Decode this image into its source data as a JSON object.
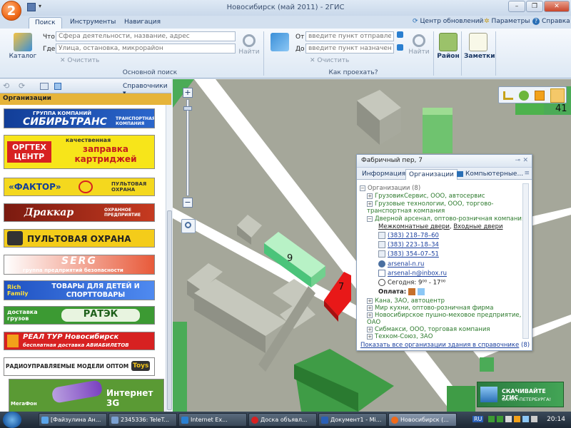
{
  "window": {
    "title": "Новосибирск (май 2011) - 2ГИС",
    "logo_text": "2",
    "btn_min": "–",
    "btn_max": "❐",
    "btn_close": "✕"
  },
  "tabs": [
    "Поиск",
    "Инструменты",
    "Навигация"
  ],
  "top_links": {
    "updates": "Центр обновлений",
    "params": "Параметры",
    "help": "Справка"
  },
  "ribbon": {
    "catalog": "Каталог",
    "what_label": "Что",
    "where_label": "Где",
    "what_placeholder": "Сфера деятельности, название, адрес",
    "where_placeholder": "Улица, остановка, микрорайон",
    "clear": "Очистить",
    "find": "Найти",
    "group1": "Основной поиск",
    "from_label": "От",
    "to_label": "До",
    "from_placeholder": "введите пункт отправления",
    "to_placeholder": "введите пункт назначения",
    "group2": "Как проехать?",
    "district": "Район",
    "notes": "Заметки"
  },
  "left_panel": {
    "directories": "Справочники",
    "section": "Организации",
    "ads": [
      {
        "main": "ГРУППА КОМПАНИЙ",
        "big": "СИБИРЬТРАНС",
        "sub": "ТРАНСПОРТНАЯ КОМПАНИЯ"
      },
      {
        "main": "ОРГТЕХ ЦЕНТР",
        "big": "заправка картриджей",
        "sub": "качественная"
      },
      {
        "main": "«ФАКТОР»",
        "big": "ПУЛЬТОВАЯ ОХРАНА",
        "sub": ""
      },
      {
        "main": "Драккар",
        "big": "ОХРАННОЕ ПРЕДПРИЯТИЕ",
        "sub": ""
      },
      {
        "main": "ПУЛЬТОВАЯ ОХРАНА",
        "big": "",
        "sub": ""
      },
      {
        "main": "SERG",
        "big": "",
        "sub": "группа предприятий безопасности"
      },
      {
        "main": "Rich Family",
        "big": "ТОВАРЫ ДЛЯ ДЕТЕЙ И СПОРТТОВАРЫ",
        "sub": ""
      },
      {
        "main": "доставка грузов",
        "big": "РАТЭК",
        "sub": ""
      },
      {
        "main": "РЕАЛ ТУР Новосибирск",
        "big": "",
        "sub": "бесплатная доставка АВИАБИЛЕТОВ"
      },
      {
        "main": "РАДИОУПРАВЛЯЕМЫЕ МОДЕЛИ ОПТОМ",
        "big": "Toys",
        "sub": ""
      },
      {
        "main": "МегаФон",
        "big": "Интернет 3G",
        "sub": ""
      }
    ]
  },
  "map": {
    "building9": "9",
    "building7": "7",
    "building41": "41",
    "promo_main": "СКАЧИВАЙТЕ 2ГИС",
    "promo_sub": "САНКТ-ПЕТЕРБУРГА!"
  },
  "popup": {
    "title": "Фабричный пер, 7",
    "tabs": [
      "Информация",
      "Организации",
      "Компьютерные..."
    ],
    "root": "Организации (8)",
    "orgs_top": [
      "ГрузовикСервис, ООО, автосервис",
      "Грузовые технологии, ООО, торгово-",
      "транспортная компания",
      "Дверной арсенал, оптово-розничная компания"
    ],
    "categories": [
      "Межкомнатные двери",
      "Входные двери"
    ],
    "phones": [
      "(383) 218–78–60",
      "(383) 223–18–34",
      "(383) 354–07–51"
    ],
    "site": "arsenal-n.ru",
    "email": "arsenal-n@inbox.ru",
    "today": "Сегодня: 9⁰⁰ - 17⁰⁰",
    "payment": "Оплата:",
    "orgs_bottom": [
      "Кана, ЗАО, автоцентр",
      "Мир кухни, оптово-розничная фирма",
      "Новосибирское пушно-меховое предприятие,",
      "ОАО",
      "Сибмакси, ООО, торговая компания",
      "Техком-Союз, ЗАО"
    ],
    "show_all": "Показать все организации здания в справочнике",
    "show_all_count": "(8)"
  },
  "taskbar": {
    "tasks": [
      "[Файзулина Ан...",
      "2345336: TeleT...",
      "Internet Ex...",
      "Доска объявл...",
      "Документ1 - Mi...",
      "Новосибирск (..."
    ],
    "lang": "RU",
    "clock": "20:14"
  }
}
